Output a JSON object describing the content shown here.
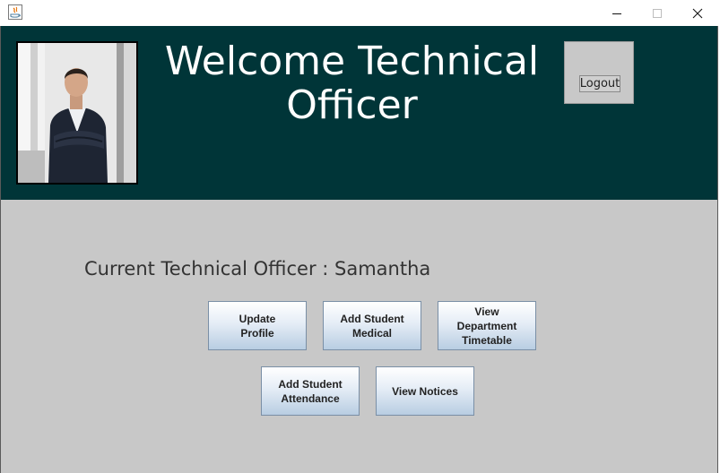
{
  "window": {
    "minimize_label": "minimize",
    "maximize_label": "maximize",
    "close_label": "close"
  },
  "header": {
    "welcome": "Welcome Technical\nOfficer",
    "logout_label": "Logout",
    "bg_color": "#003538"
  },
  "main": {
    "current_officer": "Current Technical Officer : Samantha",
    "buttons": [
      {
        "label": "Update\nProfile"
      },
      {
        "label": "Add Student\nMedical"
      },
      {
        "label": "View\nDepartment\nTimetable"
      },
      {
        "label": "Add Student\nAttendance"
      },
      {
        "label": "View Notices"
      }
    ]
  },
  "icons": [
    "java-app-icon",
    "minimize-icon",
    "maximize-icon",
    "close-icon",
    "profile-photo"
  ]
}
